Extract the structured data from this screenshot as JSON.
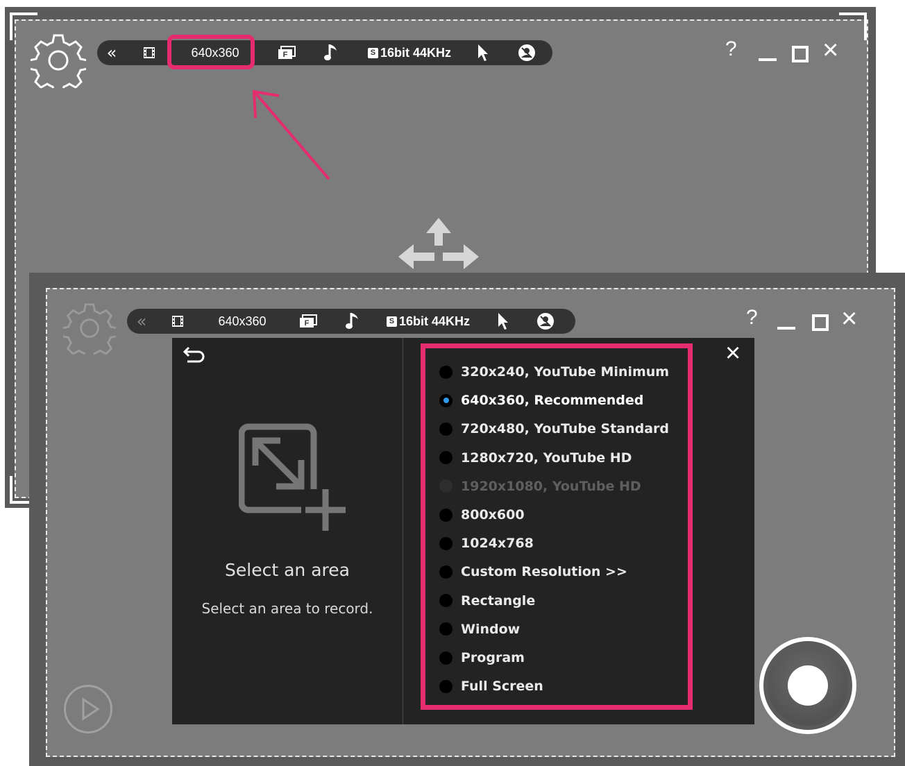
{
  "toolbar": {
    "back_glyph": "«",
    "resolution": "640x360",
    "audio": "16bit 44KHz",
    "audio_badge": "S",
    "fps_badge": "F",
    "icons": [
      "collapse-icon",
      "film-icon",
      "fullscreen-mode-icon",
      "music-note-icon",
      "cursor-icon",
      "webcam-icon"
    ]
  },
  "window_controls": {
    "help": "?",
    "minimize": "_",
    "maximize": "□",
    "close": "×"
  },
  "panel": {
    "title": "Select an area",
    "subtitle": "Select an area to record.",
    "close": "×",
    "selected_index": 1,
    "options": [
      {
        "label": "320x240, YouTube Minimum",
        "state": "normal"
      },
      {
        "label": "640x360, Recommended",
        "state": "selected"
      },
      {
        "label": "720x480, YouTube Standard",
        "state": "normal"
      },
      {
        "label": "1280x720, YouTube HD",
        "state": "normal"
      },
      {
        "label": "1920x1080, YouTube HD",
        "state": "disabled"
      },
      {
        "label": "800x600",
        "state": "normal"
      },
      {
        "label": "1024x768",
        "state": "normal"
      },
      {
        "label": "Custom Resolution >>",
        "state": "normal"
      },
      {
        "label": "Rectangle",
        "state": "normal"
      },
      {
        "label": "Window",
        "state": "normal"
      },
      {
        "label": "Program",
        "state": "normal"
      },
      {
        "label": "Full Screen",
        "state": "normal"
      }
    ]
  },
  "colors": {
    "highlight": "#e42c6f",
    "accent": "#2f9bf0",
    "toolbar_bg": "#333333",
    "panel_bg": "#232323"
  }
}
